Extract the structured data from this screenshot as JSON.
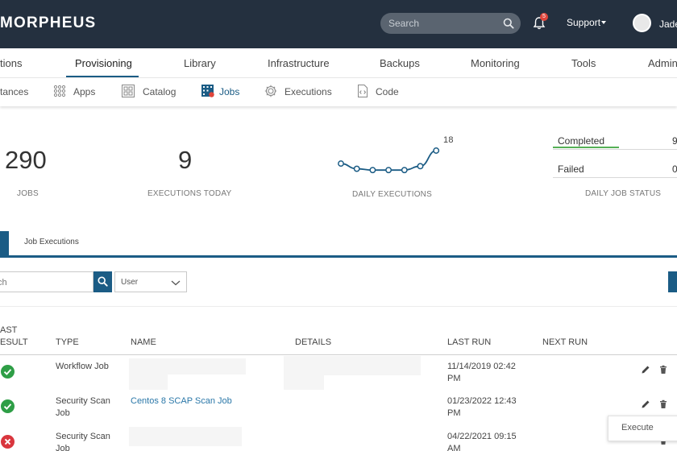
{
  "header": {
    "logo": "MORPHEUS",
    "search_placeholder": "Search",
    "notification_count": "5",
    "support_label": "Support",
    "user_name": "Jade"
  },
  "main_nav": [
    "tions",
    "Provisioning",
    "Library",
    "Infrastructure",
    "Backups",
    "Monitoring",
    "Tools",
    "Admin"
  ],
  "sub_nav": [
    "tances",
    "Apps",
    "Catalog",
    "Jobs",
    "Executions",
    "Code"
  ],
  "stats": {
    "jobs": {
      "value": "290",
      "label": "JOBS"
    },
    "executions_today": {
      "value": "9",
      "label": "EXECUTIONS TODAY"
    },
    "daily_executions": {
      "peak": "18",
      "label": "DAILY EXECUTIONS",
      "values": [
        8,
        4,
        3,
        3,
        3,
        6,
        18
      ]
    },
    "daily_job_status": {
      "label": "DAILY JOB STATUS",
      "completed_label": "Completed",
      "completed_value": "9",
      "failed_label": "Failed",
      "failed_value": "0"
    }
  },
  "tabs": {
    "second": "Job Executions"
  },
  "filters": {
    "search_placeholder": "ch",
    "user_select": "User"
  },
  "table": {
    "headers": {
      "result_line1": "AST",
      "result_line2": "ESULT",
      "type": "TYPE",
      "name": "NAME",
      "details": "DETAILS",
      "last_run": "LAST RUN",
      "next_run": "NEXT RUN"
    },
    "rows": [
      {
        "result": "success",
        "type_l1": "Workflow Job",
        "type_l2": "",
        "name": "",
        "last_run_l1": "11/14/2019 02:42",
        "last_run_l2": "PM"
      },
      {
        "result": "success",
        "type_l1": "Security Scan",
        "type_l2": "Job",
        "name": "Centos 8 SCAP Scan Job",
        "last_run_l1": "01/23/2022 12:43",
        "last_run_l2": "PM"
      },
      {
        "result": "failure",
        "type_l1": "Security Scan",
        "type_l2": "Job",
        "name": "",
        "last_run_l1": "04/22/2021 09:15",
        "last_run_l2": "AM"
      }
    ]
  },
  "popup": {
    "execute_label": "Execute"
  },
  "colors": {
    "topbar": "#24303f",
    "accent": "#1b5c85",
    "success": "#2e9e46",
    "failure": "#d9363e",
    "link": "#2a77a8"
  }
}
